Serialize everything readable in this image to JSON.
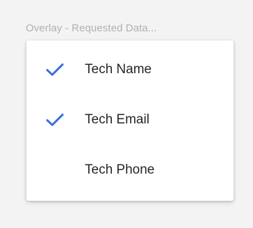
{
  "field": {
    "label": "Overlay - Requested Data..."
  },
  "menu": {
    "check_color": "#3a6fd8",
    "items": [
      {
        "label": "Tech Name",
        "checked": true,
        "icon": "check-icon"
      },
      {
        "label": "Tech Email",
        "checked": true,
        "icon": "check-icon"
      },
      {
        "label": "Tech Phone",
        "checked": false,
        "icon": "check-icon"
      }
    ]
  }
}
